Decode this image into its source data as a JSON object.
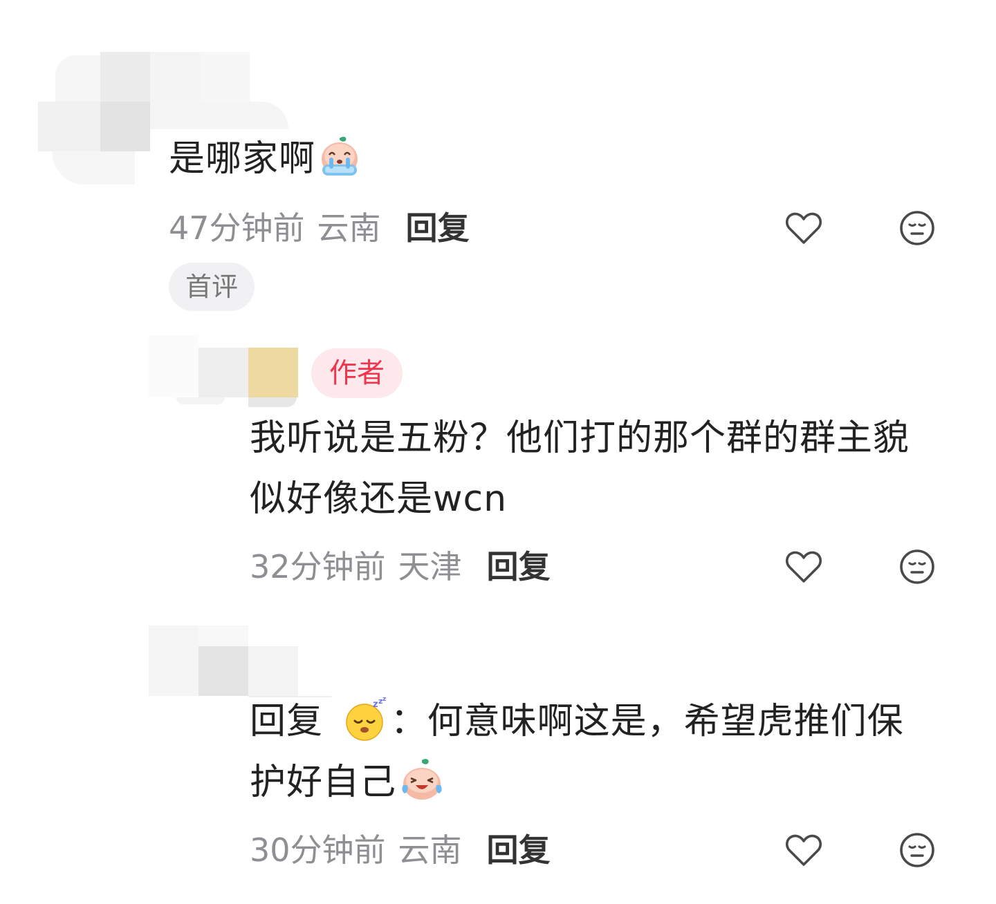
{
  "comments": [
    {
      "text_lines": [
        "是哪家啊"
      ],
      "time": "47分钟前",
      "location": "云南",
      "reply_label": "回复",
      "tag": "首评",
      "icons": [
        "crying-emoji-icon"
      ]
    },
    {
      "author_badge": "作者",
      "text_lines": [
        "我听说是五粉？他们打的那个群的群主貌",
        "似好像还是wcn"
      ],
      "time": "32分钟前",
      "location": "天津",
      "reply_label": "回复"
    },
    {
      "reply_prefix": "回复",
      "separator": "：",
      "text_first": "何意味啊这是，希望虎推们保",
      "text_second": "护好自己",
      "time": "30分钟前",
      "location": "云南",
      "reply_label": "回复",
      "icons": [
        "sleepy-emoji-icon",
        "laugh-cry-emoji-icon"
      ]
    }
  ],
  "actions": {
    "like_icon": "heart-icon",
    "dislike_icon": "meh-face-icon"
  },
  "colors": {
    "body_text": "#222222",
    "meta_text": "#8e8e93",
    "reply_text": "#333333",
    "author_badge_text": "#f0364f",
    "author_badge_bg": "#fde9ec",
    "tag_bg": "#f1f1f3"
  }
}
